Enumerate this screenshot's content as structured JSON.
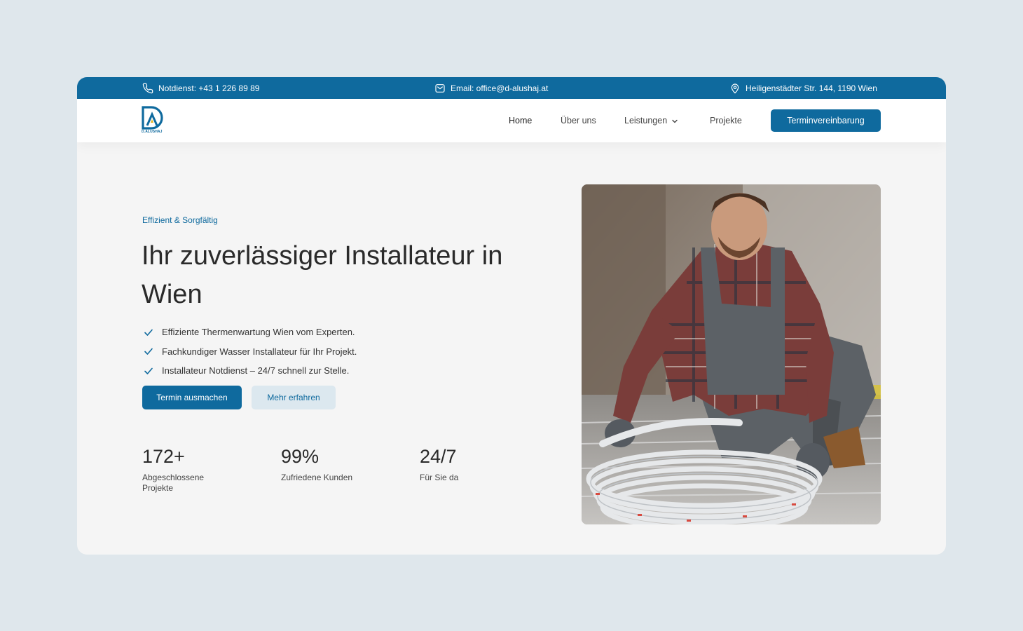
{
  "topbar": {
    "phone": "Notdienst: +43 1 226 89 89",
    "email": "Email: office@d-alushaj.at",
    "address": "Heiligenstädter Str. 144, 1190 Wien",
    "icons": [
      "phone-icon",
      "mail-icon",
      "location-pin-icon"
    ]
  },
  "nav": {
    "logo_text": "D.ALUSHAJ",
    "items": [
      {
        "label": "Home"
      },
      {
        "label": "Über uns"
      },
      {
        "label": "Leistungen"
      },
      {
        "label": "Projekte"
      }
    ],
    "cta_label": "Terminvereinbarung"
  },
  "hero": {
    "eyebrow": "Effizient & Sorgfältig",
    "headline": "Ihr zuverlässiger Installateur in Wien",
    "checks": [
      "Effiziente Thermenwartung Wien vom Experten.",
      "Fachkundiger Wasser Installateur für Ihr Projekt.",
      "Installateur Notdienst – 24/7 schnell zur Stelle."
    ],
    "primary_button": "Termin ausmachen",
    "secondary_button": "Mehr erfahren",
    "stats": [
      {
        "value": "172+",
        "label": "Abgeschlossene Projekte"
      },
      {
        "value": "99%",
        "label": "Zufriedene Kunden"
      },
      {
        "value": "24/7",
        "label": "Für Sie da"
      }
    ]
  },
  "colors": {
    "brand": "#0f6a9e",
    "page_bg": "#dfe7ec",
    "card_bg": "#f5f5f5",
    "secondary_btn_bg": "#dce8ef"
  }
}
